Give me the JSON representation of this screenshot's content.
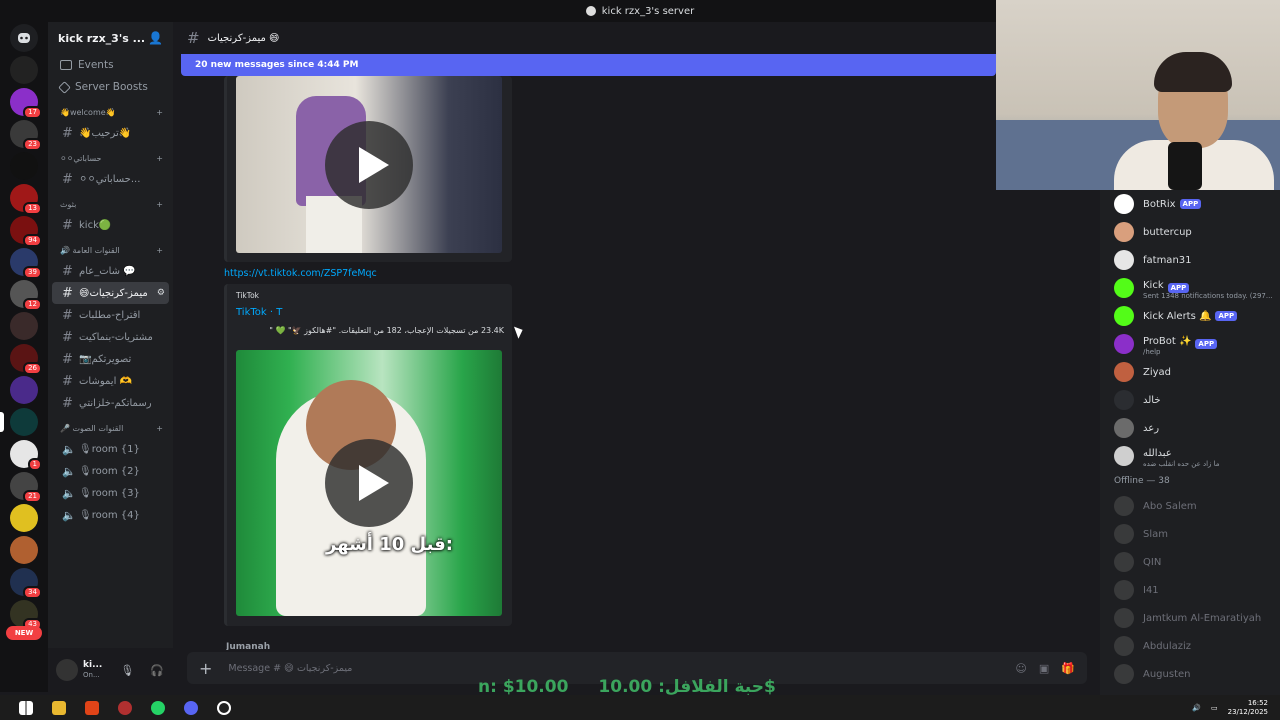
{
  "window_title": "kick rzx_3's server",
  "server_name": "kick rzx_3's ...",
  "channel_header": "ميمز-كرنجيات 😄",
  "new_messages_bar": "20 new messages since 4:44 PM",
  "nav": [
    {
      "label": "Events"
    },
    {
      "label": "Server Boosts"
    }
  ],
  "categories": [
    {
      "name": "👋welcome👋",
      "channels": [
        {
          "label": "👋ترحيب👋"
        }
      ]
    },
    {
      "name": "⚪⚪حساباتي",
      "channels": [
        {
          "label": "⚪⚪حساباتي..."
        }
      ]
    },
    {
      "name": "بثوث",
      "channels": [
        {
          "label": "kick🟢"
        }
      ]
    },
    {
      "name": "🔊 القنوات العامة",
      "channels": [
        {
          "label": "شات_عام 💬"
        },
        {
          "label": "😄ميمز-كرنجيات",
          "active": true
        },
        {
          "label": "اقتراح-مطلبات"
        },
        {
          "label": "مشتريات-بنماكيت"
        },
        {
          "label": "📷تصويرتكم"
        },
        {
          "label": "ايموشات 🫶"
        },
        {
          "label": "رسماتكم-خلزانتي"
        }
      ]
    },
    {
      "name": "🎤 القنوات الصوت",
      "channels": [
        {
          "label": "🎙room {1}"
        },
        {
          "label": "🎙room {2}"
        },
        {
          "label": "🎙room {3}"
        },
        {
          "label": "🎙room {4}"
        }
      ]
    }
  ],
  "server_badges": [
    "17",
    "23",
    "13",
    "94",
    "39",
    "12",
    "26",
    "1",
    "21",
    "34",
    "43"
  ],
  "new_pill": "NEW",
  "link_url": "https://vt.tiktok.com/ZSP7feMqc",
  "embed": {
    "provider": "TikTok",
    "title": "TikTok · T",
    "description": "23.4K من تسجيلات الإعجاب، 182 من التعليقات. \"#هالكوز 🦅\" 💚 \""
  },
  "video_caption": "قبل 10 أشهر:",
  "next_author": "Jumanah",
  "message_placeholder": "Message # 😄 ميمز-كرنجيات",
  "ticker": [
    "n: $10.00",
    "حبة الفلافل: 10.00$"
  ],
  "user": {
    "name": "ki...",
    "status": "On..."
  },
  "members_online": [
    {
      "name": "BotRix",
      "app": "APP",
      "color": "#ffffff",
      "sub": ""
    },
    {
      "name": "buttercup",
      "app": "",
      "color": "#d99f7d",
      "sub": ""
    },
    {
      "name": "fatman31",
      "app": "",
      "color": "#e6e6e6",
      "sub": ""
    },
    {
      "name": "Kick",
      "app": "APP",
      "color": "#53fc18",
      "sub": "Sent 1348 notifications today. (297..."
    },
    {
      "name": "Kick Alerts 🔔",
      "app": "APP",
      "color": "#53fc18",
      "sub": ""
    },
    {
      "name": "ProBot ✨",
      "app": "APP",
      "color": "#8b2fc9",
      "sub": "/help"
    },
    {
      "name": "Ziyad",
      "app": "",
      "color": "#c06040",
      "sub": ""
    },
    {
      "name": "خالد",
      "app": "",
      "color": "#2b2d31",
      "sub": ""
    },
    {
      "name": "رعد",
      "app": "",
      "color": "#6b6b6b",
      "sub": ""
    },
    {
      "name": "عبدالله",
      "app": "",
      "color": "#cfcfcf",
      "sub": "ما زاد عن حده انقلب ضده"
    }
  ],
  "offline_header": "Offline — 38",
  "members_offline": [
    {
      "name": "Abo Salem"
    },
    {
      "name": "Slam"
    },
    {
      "name": "QIN"
    },
    {
      "name": "I41"
    },
    {
      "name": "Jamtkum Al-Emaratiyah"
    },
    {
      "name": "Abdulaziz"
    },
    {
      "name": "Augusten"
    }
  ],
  "clock": {
    "time": "16:52",
    "date": "23/12/2025"
  },
  "colors": {
    "accent": "#5865f2",
    "link": "#00a8fc",
    "online": "#23a55a",
    "danger": "#f23f42"
  }
}
